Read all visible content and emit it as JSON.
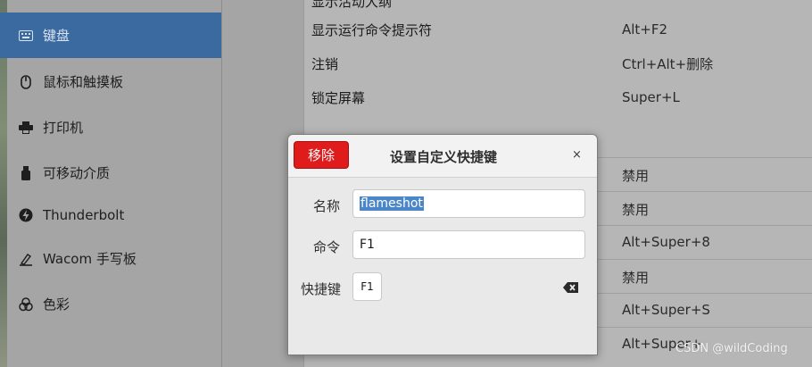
{
  "sidebar": {
    "items": [
      {
        "label": "键盘",
        "icon": "keyboard-icon"
      },
      {
        "label": "鼠标和触摸板",
        "icon": "mouse-icon"
      },
      {
        "label": "打印机",
        "icon": "printer-icon"
      },
      {
        "label": "可移动介质",
        "icon": "removable-media-icon"
      },
      {
        "label": "Thunderbolt",
        "icon": "thunderbolt-icon"
      },
      {
        "label": "Wacom 手写板",
        "icon": "tablet-icon"
      },
      {
        "label": "色彩",
        "icon": "color-icon"
      }
    ]
  },
  "shortcuts": {
    "top_partial": "显示活动大纲",
    "rows": [
      {
        "name": "显示运行命令提示符",
        "key": "Alt+F2"
      },
      {
        "name": "注销",
        "key": "Ctrl+Alt+删除"
      },
      {
        "name": "锁定屏幕",
        "key": "Super+L"
      }
    ],
    "custom_keys": [
      "禁用",
      "禁用",
      "Alt+Super+8",
      "禁用",
      "Alt+Super+S",
      "Alt+Super+"
    ]
  },
  "dialog": {
    "remove_label": "移除",
    "title": "设置自定义快捷键",
    "close_glyph": "×",
    "name_label": "名称",
    "name_value": "flameshot",
    "command_label": "命令",
    "command_value": "F1",
    "shortcut_label": "快捷键",
    "shortcut_value": "F1"
  },
  "watermark": "CSDN @wildCoding",
  "colors": {
    "active_item": "#3b6aa0",
    "remove_button": "#e01b1b",
    "selection": "#4a86c8"
  }
}
